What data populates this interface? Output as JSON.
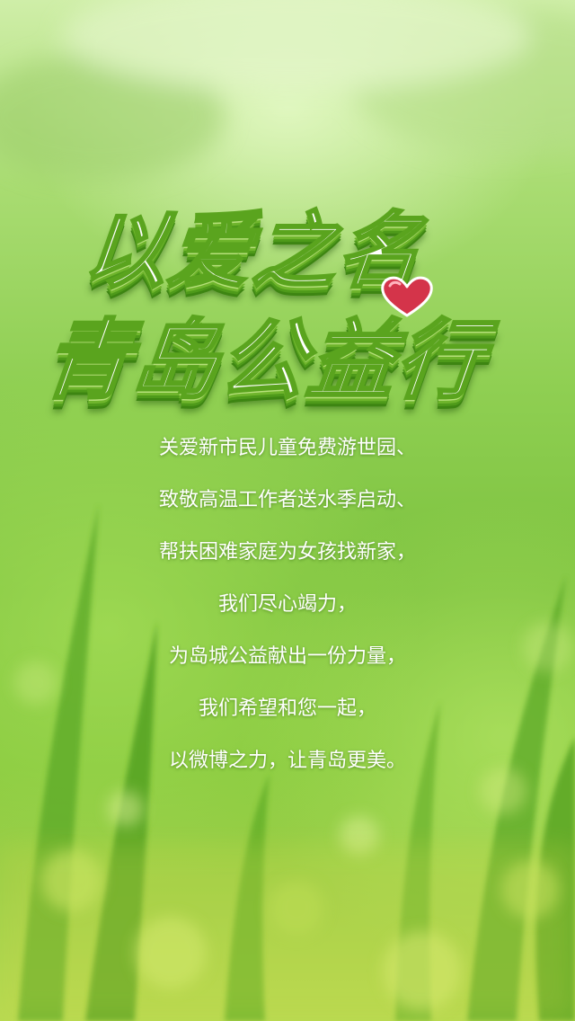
{
  "title": {
    "line1": "以爱之名",
    "line2": "青岛公益行"
  },
  "icons": {
    "heart": "heart-icon"
  },
  "colors": {
    "background": "#8fcf52",
    "title_stroke": "#5aa41e",
    "title_depth": "#3d8512",
    "heart": "#d4344a",
    "text": "#ffffff"
  },
  "message": {
    "lines": [
      "关爱新市民儿童免费游世园、",
      "致敬高温工作者送水季启动、",
      "帮扶困难家庭为女孩找新家，",
      "我们尽心竭力，",
      "为岛城公益献出一份力量，",
      "我们希望和您一起，",
      "以微博之力，让青岛更美。"
    ]
  }
}
